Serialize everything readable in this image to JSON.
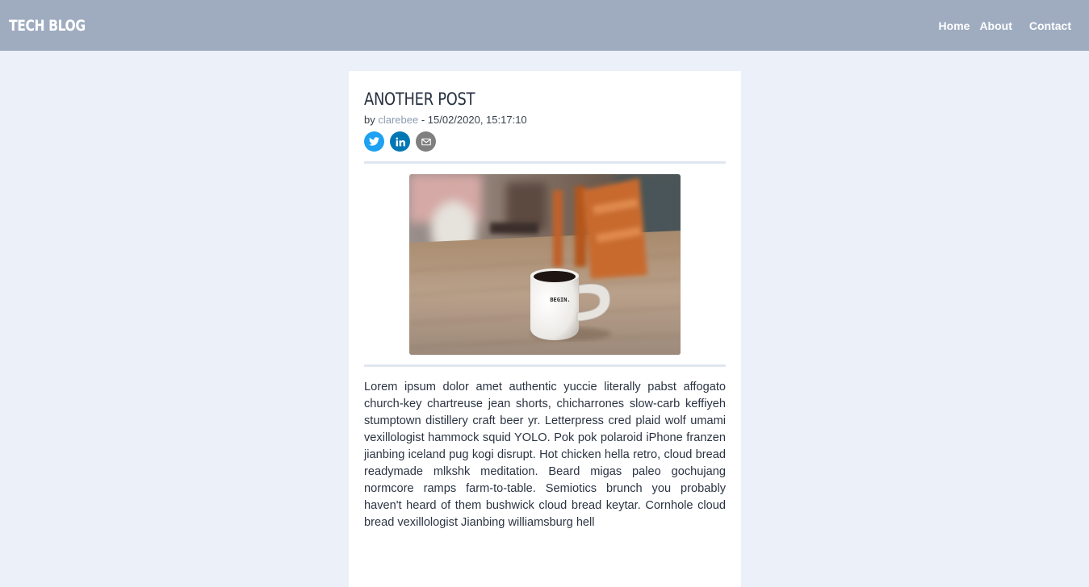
{
  "navbar": {
    "brand": "TECH BLOG",
    "links": [
      "Home",
      "About",
      "Contact"
    ]
  },
  "post": {
    "title": "ANOTHER POST",
    "meta_prefix": "by ",
    "author": "clarebee",
    "meta_suffix": " - 15/02/2020, 15:17:10",
    "share": [
      {
        "icon": "twitter-icon",
        "color": "#1da1f2"
      },
      {
        "icon": "linkedin-icon",
        "color": "#0077b5"
      },
      {
        "icon": "email-icon",
        "color": "#7f7f7f"
      }
    ],
    "image_mug_text": "BEGIN.",
    "body": "Lorem ipsum dolor amet authentic yuccie literally pabst affogato church-key chartreuse jean shorts, chicharrones slow-carb keffiyeh stumptown distillery craft beer yr. Letterpress cred plaid wolf umami vexillologist hammock squid YOLO. Pok pok polaroid iPhone franzen jianbing iceland pug kogi disrupt. Hot chicken hella retro, cloud bread readymade mlkshk meditation. Beard migas paleo gochujang normcore ramps farm-to-table. Semiotics brunch you probably haven't heard of them bushwick cloud bread keytar. Cornhole cloud bread vexillologist Jianbing williamsburg hell"
  },
  "colors": {
    "navbar": "#9facc0",
    "page_background": "#ecf0f8",
    "author_link": "#8e9cb0"
  }
}
